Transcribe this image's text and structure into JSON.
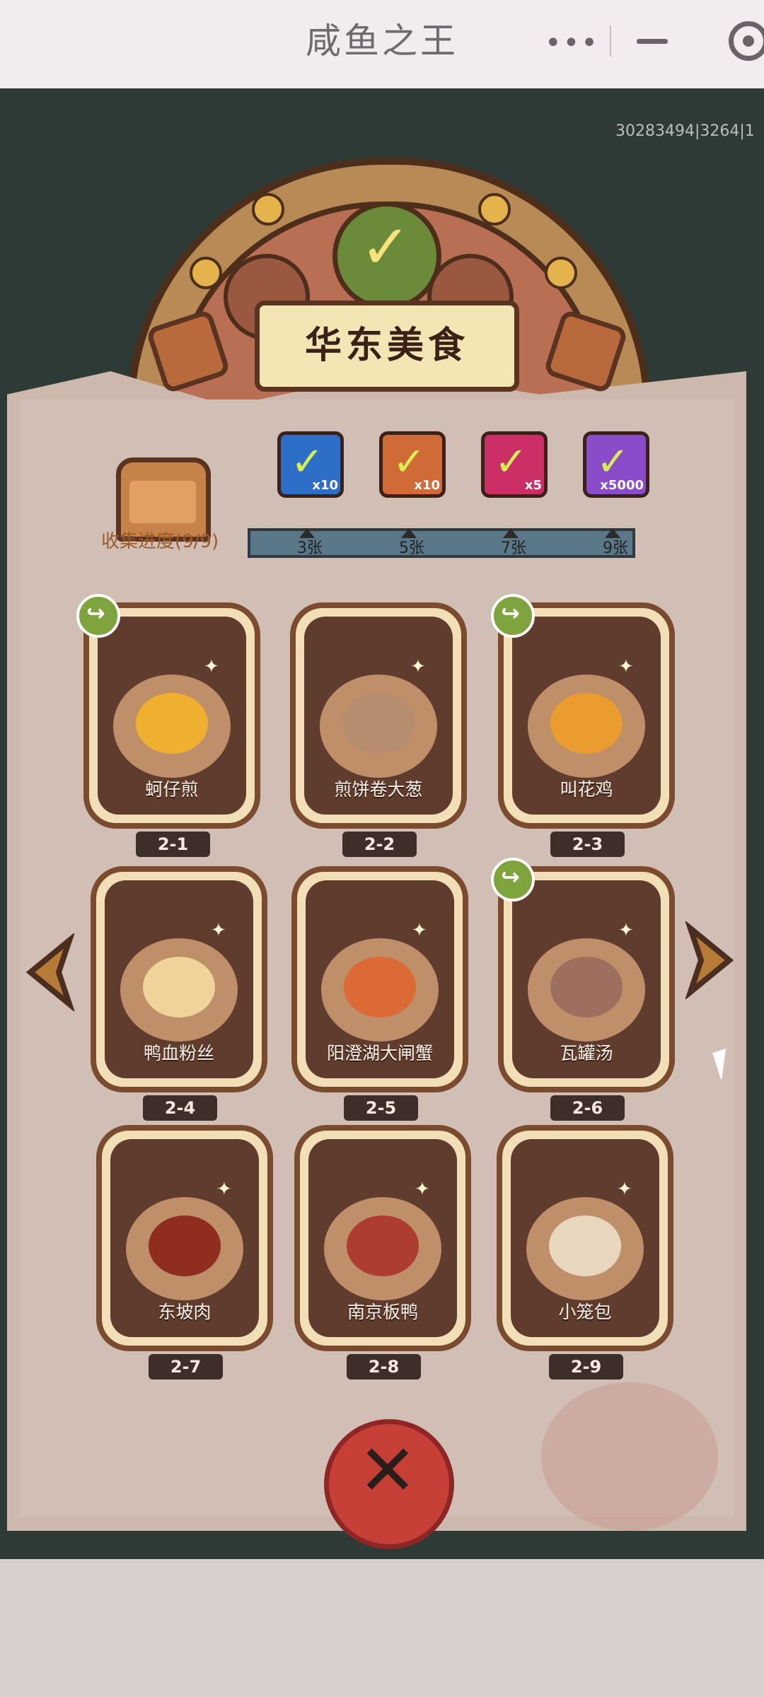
{
  "app": {
    "title": "咸鱼之王"
  },
  "topbar": {
    "menu_icon": "more-dots-icon",
    "minimize_icon": "minimize-icon",
    "target_icon": "target-icon"
  },
  "game": {
    "id_text": "30283494|3264|1",
    "banner_title": "华东美食",
    "collection_progress": "收集进度(9/9)",
    "rewards": [
      {
        "icon": "chest-icon",
        "qty": "x10",
        "color": "#2d6ec8"
      },
      {
        "icon": "key-icon",
        "qty": "x10",
        "color": "#d06a37"
      },
      {
        "icon": "orb-icon",
        "qty": "x5",
        "color": "#cc2f66"
      },
      {
        "icon": "gem-icon",
        "qty": "x5000",
        "color": "#8a4cc8"
      }
    ],
    "milestones": [
      "3张",
      "5张",
      "7张",
      "9张"
    ],
    "cards": [
      {
        "name": "蚵仔煎",
        "level": "2-1",
        "food_color": "#f0b02f",
        "share": true
      },
      {
        "name": "煎饼卷大葱",
        "level": "2-2",
        "food_color": "#b68d6f",
        "share": false
      },
      {
        "name": "叫花鸡",
        "level": "2-3",
        "food_color": "#ea9c2f",
        "share": true
      },
      {
        "name": "鸭血粉丝",
        "level": "2-4",
        "food_color": "#f0d39b",
        "share": false
      },
      {
        "name": "阳澄湖大闸蟹",
        "level": "2-5",
        "food_color": "#db6a36",
        "share": false
      },
      {
        "name": "瓦罐汤",
        "level": "2-6",
        "food_color": "#9e6f5e",
        "share": true
      },
      {
        "name": "东坡肉",
        "level": "2-7",
        "food_color": "#8f2e1f",
        "share": false
      },
      {
        "name": "南京板鸭",
        "level": "2-8",
        "food_color": "#ad3e2f",
        "share": false
      },
      {
        "name": "小笼包",
        "level": "2-9",
        "food_color": "#e8d7bf",
        "share": false
      }
    ],
    "nav": {
      "prev_icon": "left-arrow-icon",
      "next_icon": "right-arrow-icon",
      "close_icon": "close-icon"
    }
  }
}
